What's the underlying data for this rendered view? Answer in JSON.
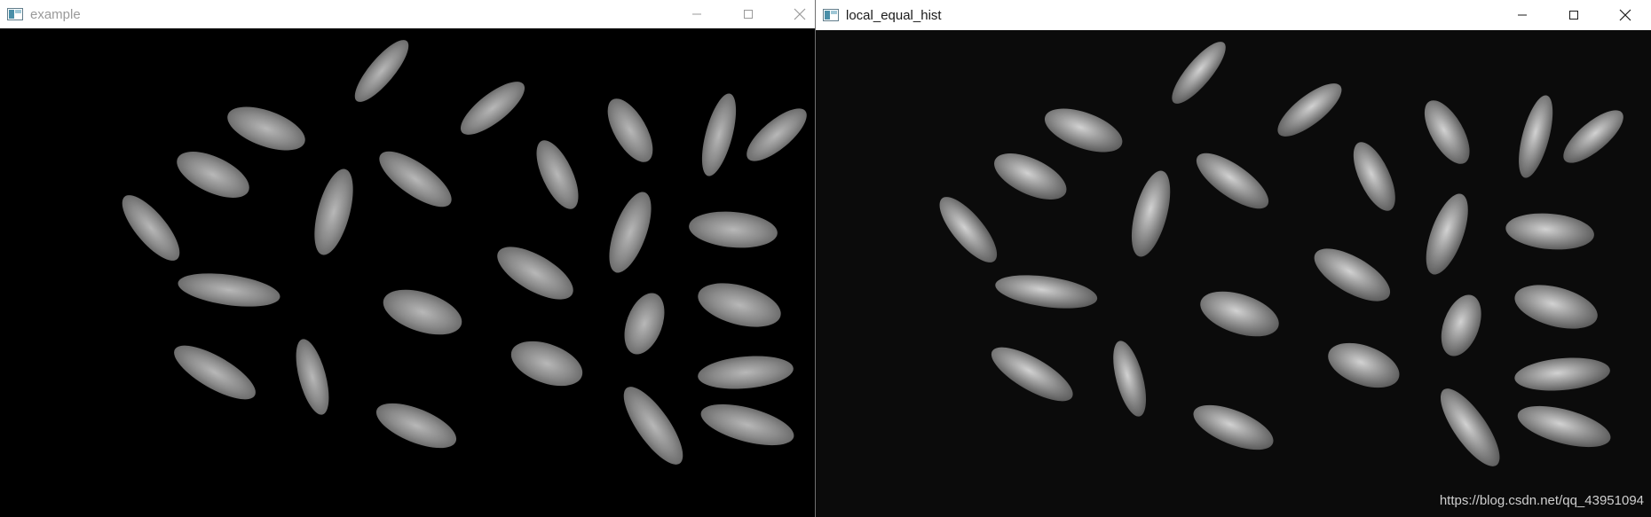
{
  "windows": [
    {
      "title": "example",
      "focused": false,
      "icon": "opencv-window-icon",
      "controls": [
        "minimize-icon",
        "maximize-icon",
        "close-icon"
      ]
    },
    {
      "title": "local_equal_hist",
      "focused": true,
      "icon": "opencv-window-icon",
      "controls": [
        "minimize-icon",
        "maximize-icon",
        "close-icon"
      ]
    }
  ],
  "image_subject": "rice-grains-grayscale",
  "colors": {
    "titlebar_bg": "#ffffff",
    "inactive_title": "#9a9a9a",
    "active_title": "#1a1a1a",
    "image_bg_left": "#000000",
    "image_bg_right": "#0b0b0b"
  },
  "watermark": "https://blog.csdn.net/qq_43951094"
}
